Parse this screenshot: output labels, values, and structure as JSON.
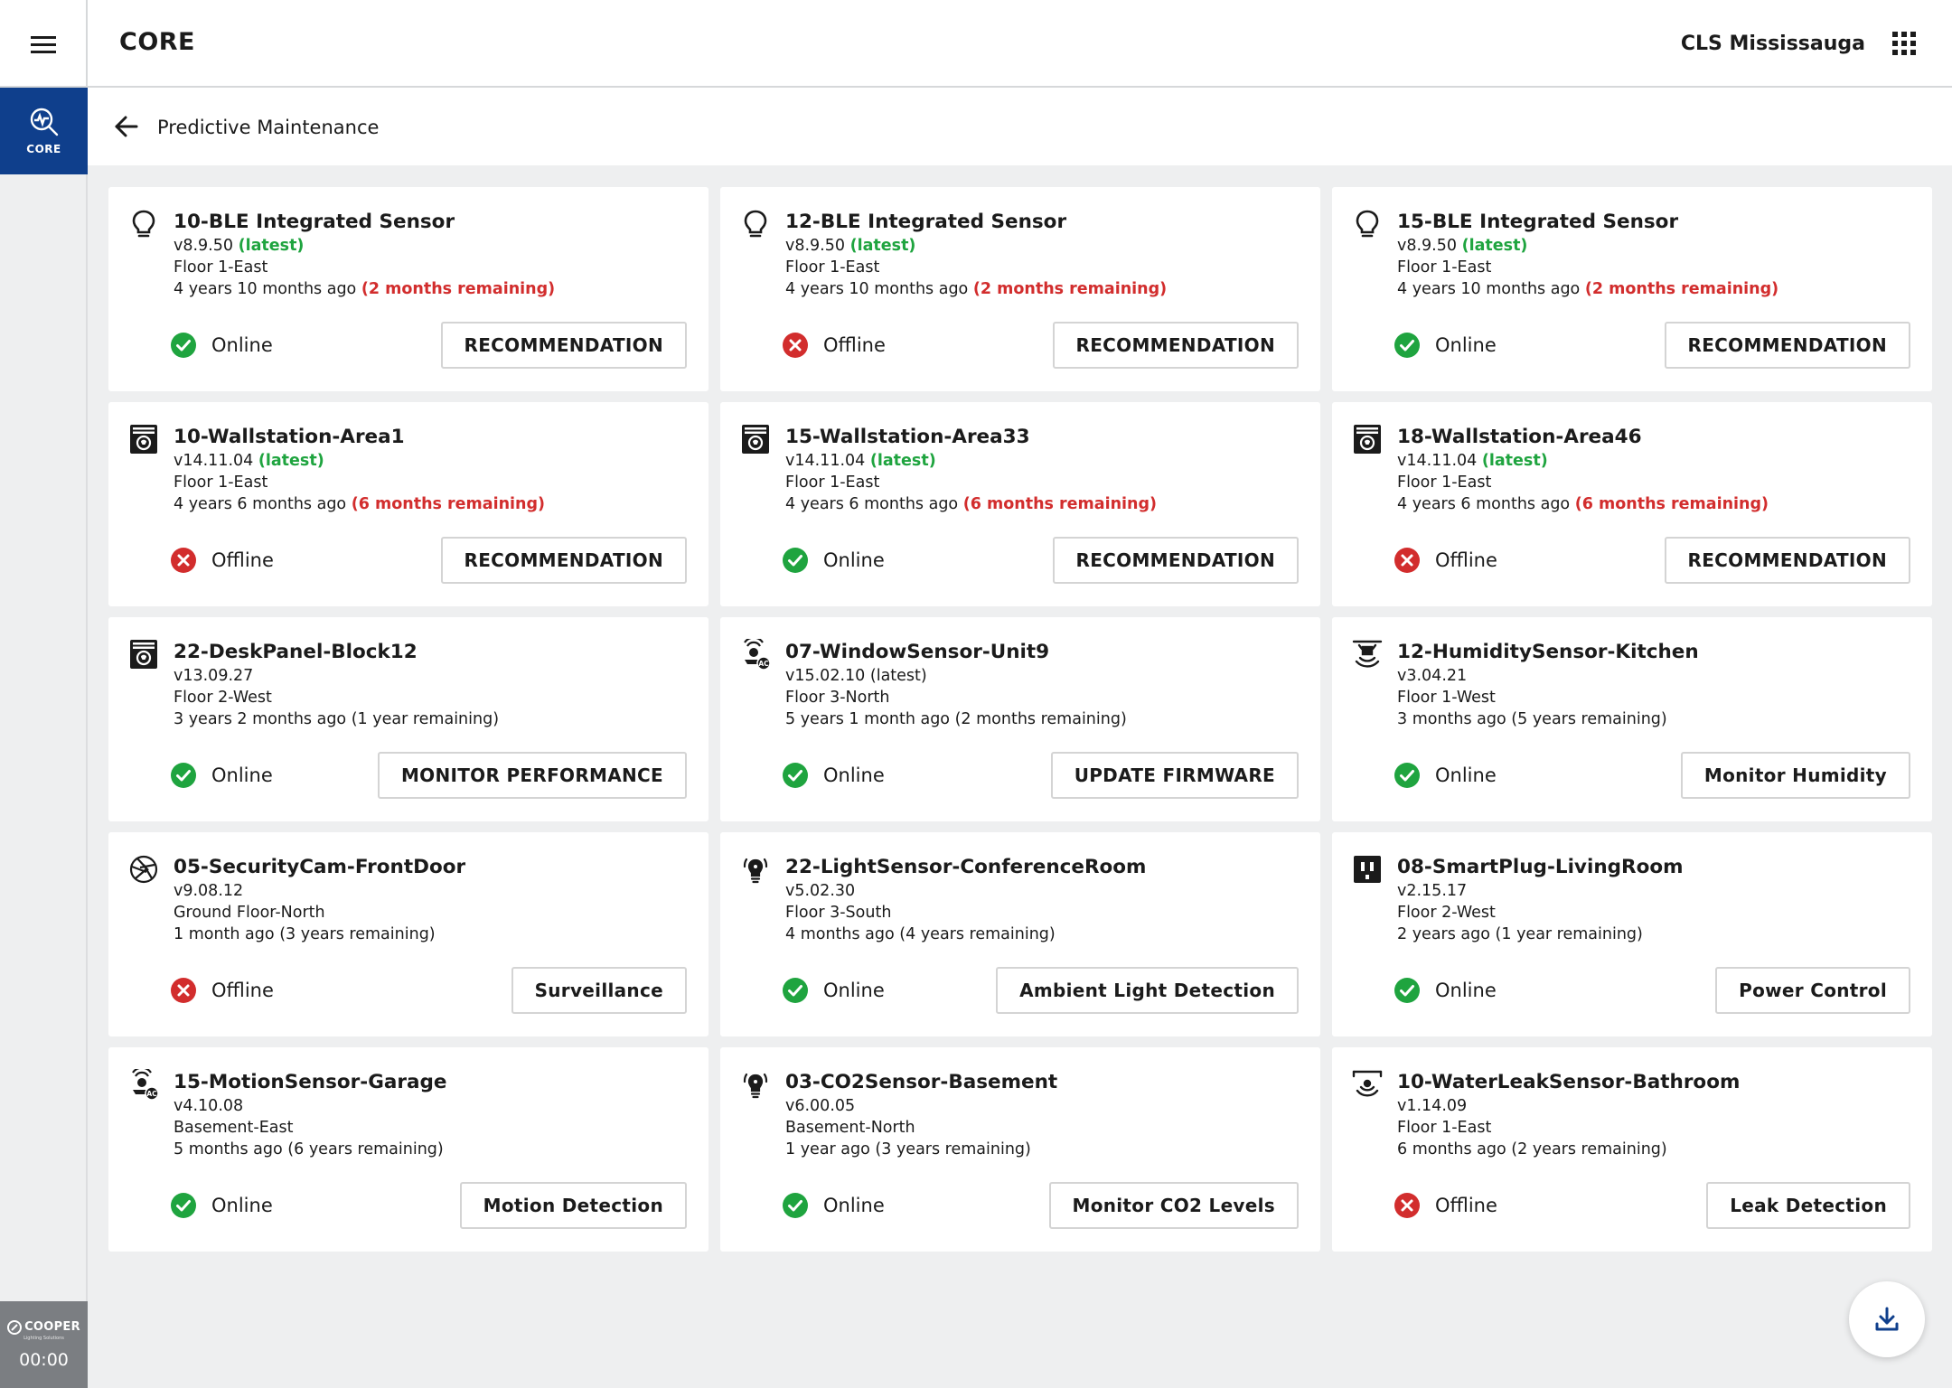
{
  "header": {
    "app_title": "CORE",
    "site_name": "CLS Mississauga",
    "menu_icon": "hamburger-icon",
    "apps_icon": "apps-grid-icon"
  },
  "sidebar": {
    "core_label": "CORE",
    "core_icon": "maintenance-search-icon",
    "brand_name": "COOPER",
    "brand_sub": "Lighting Solutions",
    "timer": "00:00"
  },
  "subheader": {
    "title": "Predictive Maintenance",
    "back_icon": "arrow-left-icon"
  },
  "colors": {
    "primary": "#0f3f8c",
    "online": "#1fa43f",
    "offline": "#d22d2d",
    "latest": "#1fa43f",
    "remaining_warning": "#d22d2d"
  },
  "devices": [
    {
      "name": "10-BLE Integrated Sensor",
      "icon": "bulb",
      "version": "v8.9.50",
      "version_tag": "(latest)",
      "tag_style": "green",
      "location": "Floor 1-East",
      "age": "4 years 10 months ago",
      "remaining": "(2 months remaining)",
      "remaining_style": "red",
      "status": "Online",
      "status_state": "online",
      "action": "RECOMMENDATION"
    },
    {
      "name": "12-BLE Integrated Sensor",
      "icon": "bulb",
      "version": "v8.9.50",
      "version_tag": "(latest)",
      "tag_style": "green",
      "location": "Floor 1-East",
      "age": "4 years 10 months ago",
      "remaining": "(2 months remaining)",
      "remaining_style": "red",
      "status": "Offline",
      "status_state": "offline",
      "action": "RECOMMENDATION"
    },
    {
      "name": "15-BLE Integrated Sensor",
      "icon": "bulb",
      "version": "v8.9.50",
      "version_tag": "(latest)",
      "tag_style": "green",
      "location": "Floor 1-East",
      "age": "4 years 10 months ago",
      "remaining": "(2 months remaining)",
      "remaining_style": "red",
      "status": "Online",
      "status_state": "online",
      "action": "RECOMMENDATION"
    },
    {
      "name": "10-Wallstation-Area1",
      "icon": "wallstation",
      "version": "v14.11.04",
      "version_tag": "(latest)",
      "tag_style": "green",
      "location": "Floor 1-East",
      "age": "4 years 6 months ago",
      "remaining": "(6 months remaining)",
      "remaining_style": "red",
      "status": "Offline",
      "status_state": "offline",
      "action": "RECOMMENDATION"
    },
    {
      "name": "15-Wallstation-Area33",
      "icon": "wallstation",
      "version": "v14.11.04",
      "version_tag": "(latest)",
      "tag_style": "green",
      "location": "Floor 1-East",
      "age": "4 years 6 months ago",
      "remaining": "(6 months remaining)",
      "remaining_style": "red",
      "status": "Online",
      "status_state": "online",
      "action": "RECOMMENDATION"
    },
    {
      "name": "18-Wallstation-Area46",
      "icon": "wallstation",
      "version": "v14.11.04",
      "version_tag": "(latest)",
      "tag_style": "green",
      "location": "Floor 1-East",
      "age": "4 years 6 months ago",
      "remaining": "(6 months remaining)",
      "remaining_style": "red",
      "status": "Offline",
      "status_state": "offline",
      "action": "RECOMMENDATION"
    },
    {
      "name": "22-DeskPanel-Block12",
      "icon": "wallstation",
      "version": "v13.09.27",
      "version_tag": "",
      "tag_style": "plain",
      "location": "Floor 2-West",
      "age": "3 years 2 months ago",
      "remaining": "(1 year remaining)",
      "remaining_style": "plain",
      "status": "Online",
      "status_state": "online",
      "action": "MONITOR PERFORMANCE"
    },
    {
      "name": "07-WindowSensor-Unit9",
      "icon": "ac-sensor",
      "version": "v15.02.10",
      "version_tag": "(latest)",
      "tag_style": "plain",
      "location": "Floor 3-North",
      "age": "5 years 1 month ago",
      "remaining": "(2 months remaining)",
      "remaining_style": "plain",
      "status": "Online",
      "status_state": "online",
      "action": "UPDATE FIRMWARE"
    },
    {
      "name": "12-HumiditySensor-Kitchen",
      "icon": "ceiling-sensor",
      "version": "v3.04.21",
      "version_tag": "",
      "tag_style": "plain",
      "location": "Floor 1-West",
      "age": "3 months ago",
      "remaining": "(5 years remaining)",
      "remaining_style": "plain",
      "status": "Online",
      "status_state": "online",
      "action": "Monitor Humidity"
    },
    {
      "name": "05-SecurityCam-FrontDoor",
      "icon": "camera-shutter",
      "version": "v9.08.12",
      "version_tag": "",
      "tag_style": "plain",
      "location": "Ground Floor-North",
      "age": "1 month ago",
      "remaining": "(3 years remaining)",
      "remaining_style": "plain",
      "status": "Offline",
      "status_state": "offline",
      "action": "Surveillance"
    },
    {
      "name": "22-LightSensor-ConferenceRoom",
      "icon": "smart-bulb",
      "version": "v5.02.30",
      "version_tag": "",
      "tag_style": "plain",
      "location": "Floor 3-South",
      "age": "4 months ago",
      "remaining": "(4 years remaining)",
      "remaining_style": "plain",
      "status": "Online",
      "status_state": "online",
      "action": "Ambient Light Detection"
    },
    {
      "name": "08-SmartPlug-LivingRoom",
      "icon": "plug",
      "version": "v2.15.17",
      "version_tag": "",
      "tag_style": "plain",
      "location": "Floor 2-West",
      "age": "2 years ago",
      "remaining": "(1 year remaining)",
      "remaining_style": "plain",
      "status": "Online",
      "status_state": "online",
      "action": "Power Control"
    },
    {
      "name": "15-MotionSensor-Garage",
      "icon": "ac-sensor",
      "version": "v4.10.08",
      "version_tag": "",
      "tag_style": "plain",
      "location": "Basement-East",
      "age": "5 months ago",
      "remaining": "(6 years remaining)",
      "remaining_style": "plain",
      "status": "Online",
      "status_state": "online",
      "action": "Motion Detection"
    },
    {
      "name": "03-CO2Sensor-Basement",
      "icon": "smart-bulb",
      "version": "v6.00.05",
      "version_tag": "",
      "tag_style": "plain",
      "location": "Basement-North",
      "age": "1 year ago",
      "remaining": "(3 years remaining)",
      "remaining_style": "plain",
      "status": "Online",
      "status_state": "online",
      "action": "Monitor CO2 Levels"
    },
    {
      "name": "10-WaterLeakSensor-Bathroom",
      "icon": "ceiling-signal",
      "version": "v1.14.09",
      "version_tag": "",
      "tag_style": "plain",
      "location": "Floor 1-East",
      "age": "6 months ago",
      "remaining": "(2 years remaining)",
      "remaining_style": "plain",
      "status": "Offline",
      "status_state": "offline",
      "action": "Leak Detection"
    }
  ],
  "fab": {
    "icon": "download-icon"
  }
}
